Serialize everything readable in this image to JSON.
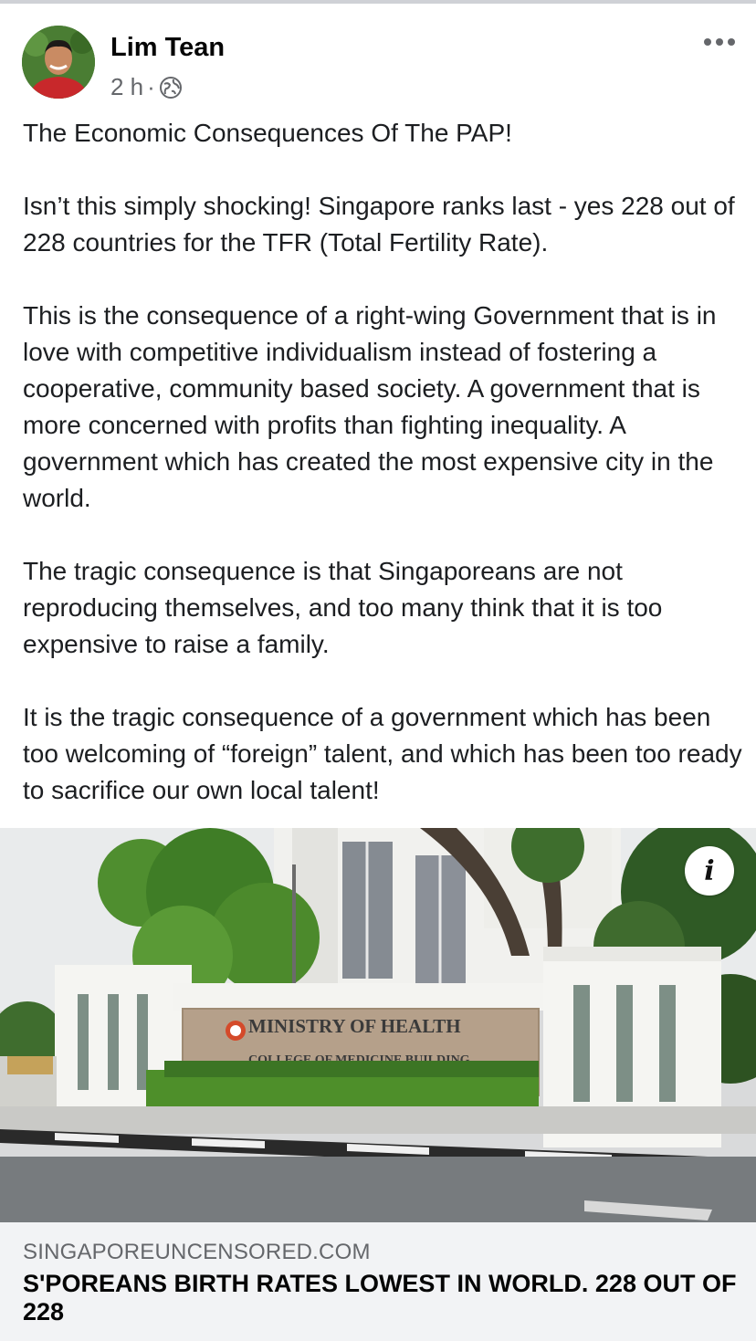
{
  "post": {
    "author": "Lim Tean",
    "time": "2 h",
    "separator": "·",
    "privacy_icon": "globe-icon",
    "more_icon": "more-options-icon",
    "paragraphs": [
      "The Economic Consequences Of The PAP!",
      "Isn’t this simply shocking! Singapore ranks last - yes 228 out of 228 countries for the TFR (Total Fertility Rate).",
      "This is the consequence of a right-wing Government that is in love with competitive individualism instead of fostering a cooperative, community based society. A government that is more concerned with profits than fighting inequality. A government which has created the most expensive city in the world.",
      "The tragic consequence is that Singaporeans are not reproducing themselves, and too many think that it is too expensive to raise a family.",
      "It is the tragic consequence of a government which has been too welcoming of “foreign” talent, and which has been too ready to sacrifice our own local talent!"
    ]
  },
  "link_preview": {
    "image_sign_line1": "MINISTRY OF HEALTH",
    "image_sign_line2": "COLLEGE OF MEDICINE BUILDING",
    "info_label": "i",
    "domain": "SINGAPOREUNCENSORED.COM",
    "headline": "S'POREANS BIRTH RATES LOWEST IN WORLD. 228 OUT OF 228"
  }
}
